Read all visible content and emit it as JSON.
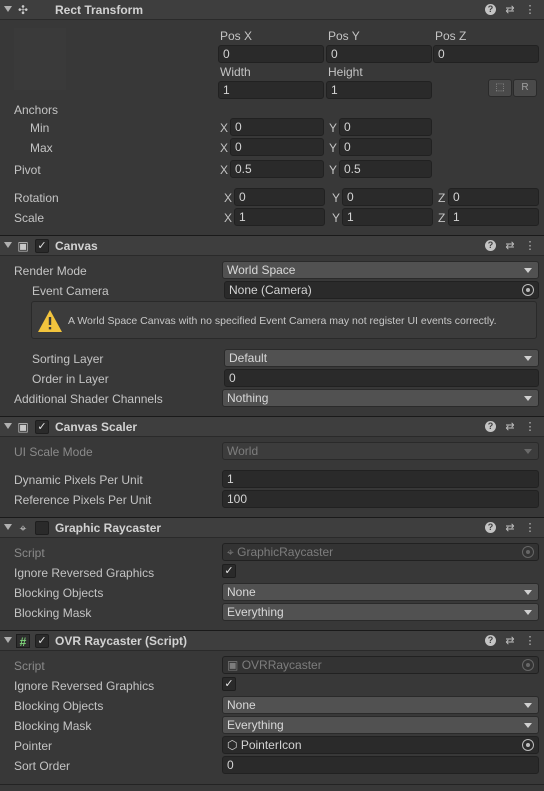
{
  "rect_transform": {
    "title": "Rect Transform",
    "pos_x_label": "Pos X",
    "pos_y_label": "Pos Y",
    "pos_z_label": "Pos Z",
    "pos_x": "0",
    "pos_y": "0",
    "pos_z": "0",
    "width_label": "Width",
    "height_label": "Height",
    "width": "1",
    "height": "1",
    "r_button": "R",
    "anchors_label": "Anchors",
    "min_label": "Min",
    "max_label": "Max",
    "min_x": "0",
    "min_y": "0",
    "max_x": "0",
    "max_y": "0",
    "pivot_label": "Pivot",
    "pivot_x": "0.5",
    "pivot_y": "0.5",
    "rotation_label": "Rotation",
    "rot_x": "0",
    "rot_y": "0",
    "rot_z": "0",
    "scale_label": "Scale",
    "scale_x": "1",
    "scale_y": "1",
    "scale_z": "1",
    "axis_x": "X",
    "axis_y": "Y",
    "axis_z": "Z"
  },
  "canvas": {
    "title": "Canvas",
    "render_mode_label": "Render Mode",
    "render_mode": "World Space",
    "event_camera_label": "Event Camera",
    "event_camera": "None (Camera)",
    "warning": "A World Space Canvas with no specified Event Camera may not register UI events correctly.",
    "sorting_layer_label": "Sorting Layer",
    "sorting_layer": "Default",
    "order_label": "Order in Layer",
    "order": "0",
    "shader_channels_label": "Additional Shader Channels",
    "shader_channels": "Nothing"
  },
  "canvas_scaler": {
    "title": "Canvas Scaler",
    "ui_scale_label": "UI Scale Mode",
    "ui_scale": "World",
    "dpu_label": "Dynamic Pixels Per Unit",
    "dpu": "1",
    "rpu_label": "Reference Pixels Per Unit",
    "rpu": "100"
  },
  "graphic_raycaster": {
    "title": "Graphic Raycaster",
    "script_label": "Script",
    "script": "GraphicRaycaster",
    "ignore_label": "Ignore Reversed Graphics",
    "blocking_objects_label": "Blocking Objects",
    "blocking_objects": "None",
    "blocking_mask_label": "Blocking Mask",
    "blocking_mask": "Everything"
  },
  "ovr_raycaster": {
    "title": "OVR Raycaster (Script)",
    "script_label": "Script",
    "script": "OVRRaycaster",
    "ignore_label": "Ignore Reversed Graphics",
    "blocking_objects_label": "Blocking Objects",
    "blocking_objects": "None",
    "blocking_mask_label": "Blocking Mask",
    "blocking_mask": "Everything",
    "pointer_label": "Pointer",
    "pointer": "PointerIcon",
    "sort_order_label": "Sort Order",
    "sort_order": "0"
  },
  "icons": {
    "check": "✓",
    "settings": "⇄",
    "more": "⋮",
    "help": "?"
  }
}
